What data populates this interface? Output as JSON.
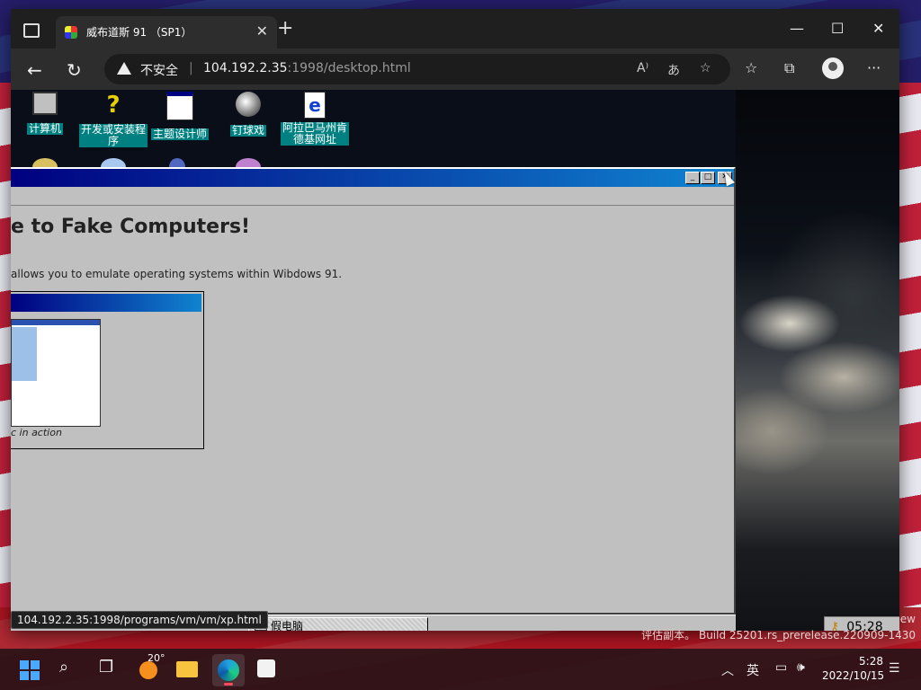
{
  "browser": {
    "tab_title": "威布道斯 91 （SP1）",
    "security_text": "不安全",
    "url_host": "104.192.2.35",
    "url_rest": ":1998/desktop.html",
    "status_url": "104.192.2.35:1998/programs/vm/vm/xp.html"
  },
  "desktop_icons": [
    {
      "label": "计算机",
      "icon": "computer-icon"
    },
    {
      "label": "开发或安装程序",
      "icon": "setup-icon"
    },
    {
      "label": "主题设计师",
      "icon": "theme-window-icon"
    },
    {
      "label": "钉球戏",
      "icon": "pinball-icon"
    },
    {
      "label": "阿拉巴马州肯德基网址",
      "icon": "ie-icon"
    }
  ],
  "app": {
    "heading": "e to Fake Computers!",
    "description": "allows you to emulate operating systems within Wibdows 91.",
    "figure_caption": "c in action"
  },
  "taskbar91": {
    "task_label": "假电脑",
    "clock": "05:28"
  },
  "windows": {
    "watermark_line1": "ew",
    "watermark_line2": "评估副本。 Build 25201.rs_prerelease.220909-1430",
    "weather_temp": "20°",
    "ime": "英",
    "time": "5:28",
    "date": "2022/10/15"
  },
  "colors": {
    "titlebar": "#000080",
    "desktop_teal": "#008080"
  }
}
